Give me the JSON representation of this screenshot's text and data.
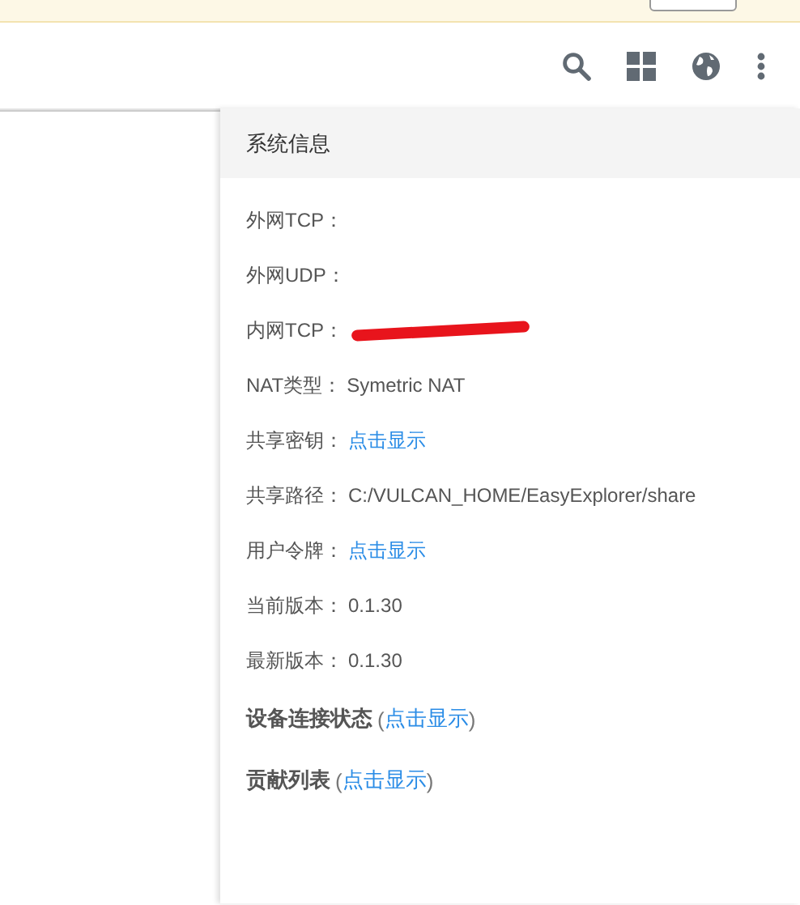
{
  "panel": {
    "title": "系统信息",
    "rows": [
      {
        "label": "外网TCP："
      },
      {
        "label": "外网UDP："
      },
      {
        "label": "内网TCP：",
        "redacted": true
      },
      {
        "kind": "text",
        "label": "NAT类型：",
        "value": "Symetric NAT"
      },
      {
        "kind": "link",
        "label": "共享密钥：",
        "value": "点击显示"
      },
      {
        "kind": "text",
        "label": "共享路径：",
        "value": "C:/VULCAN_HOME/EasyExplorer/share"
      },
      {
        "kind": "link",
        "label": "用户令牌：",
        "value": "点击显示"
      },
      {
        "kind": "text",
        "label": "当前版本：",
        "value": "0.1.30"
      },
      {
        "kind": "text",
        "label": "最新版本：",
        "value": "0.1.30"
      }
    ],
    "sections": [
      {
        "title": "设备连接状态",
        "open": "(",
        "link": "点击显示",
        "close": ")"
      },
      {
        "title": "贡献列表",
        "open": "(",
        "link": "点击显示",
        "close": ")"
      }
    ]
  }
}
